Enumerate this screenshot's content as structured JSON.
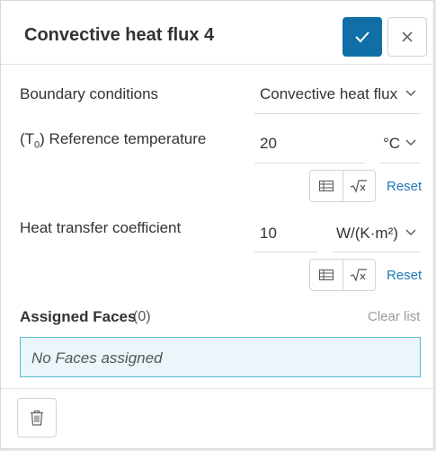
{
  "dialog": {
    "title": "Convective heat flux 4",
    "confirm_icon": "check-icon",
    "close_icon": "close-icon"
  },
  "boundary_conditions": {
    "label": "Boundary conditions",
    "selected": "Convective heat flux"
  },
  "reference_temperature": {
    "label_prefix": "(T",
    "label_sub": "0",
    "label_suffix": ") Reference temperature",
    "value": "20",
    "unit": "°C",
    "reset_label": "Reset"
  },
  "heat_transfer_coefficient": {
    "label": "Heat transfer coefficient",
    "value": "10",
    "unit": "W/(K·m²)",
    "reset_label": "Reset"
  },
  "assigned_faces": {
    "title": "Assigned Faces",
    "count": "(0)",
    "clear_label": "Clear list",
    "empty_text": "No Faces assigned"
  },
  "colors": {
    "primary": "#0f6fa6",
    "link": "#1f79b6",
    "faces_bg": "#eaf6fa",
    "faces_border": "#5ab7d3"
  }
}
